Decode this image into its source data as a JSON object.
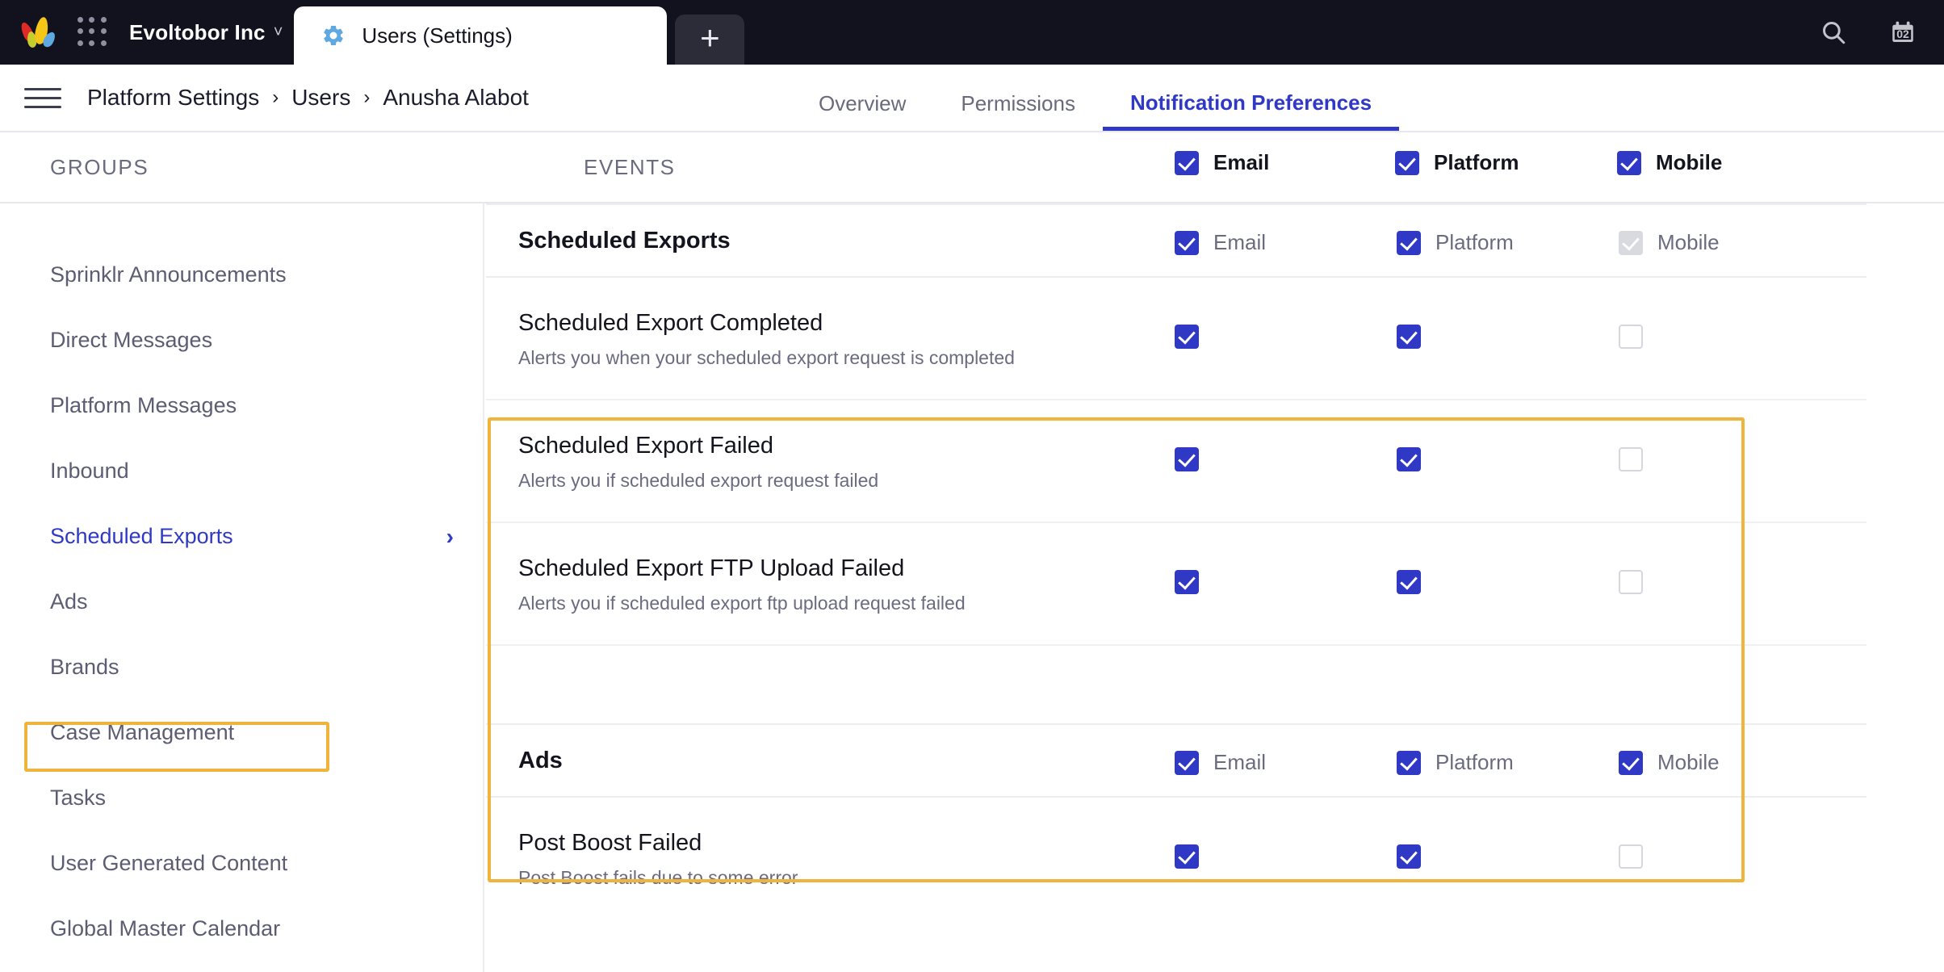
{
  "topbar": {
    "logo_icon": "sprinklr-logo-icon",
    "app_grid_icon": "app-grid-icon",
    "org_name": "Evoltobor Inc",
    "org_caret_icon": "chevron-down-icon",
    "tab_icon": "gear-icon",
    "tab_title": "Users (Settings)",
    "new_tab_label": "+",
    "search_icon": "search-icon",
    "calendar_icon": "calendar-icon",
    "calendar_day": "02"
  },
  "breadcrumb": {
    "menu_icon": "hamburger-menu-icon",
    "items": [
      "Platform Settings",
      "Users",
      "Anusha Alabot"
    ],
    "separator": "›"
  },
  "nav_tabs": [
    {
      "label": "Overview",
      "active": false
    },
    {
      "label": "Permissions",
      "active": false
    },
    {
      "label": "Notification Preferences",
      "active": true
    }
  ],
  "column_header": {
    "groups_label": "GROUPS",
    "events_label": "EVENTS",
    "channels": [
      {
        "label": "Email",
        "state": "on"
      },
      {
        "label": "Platform",
        "state": "on"
      },
      {
        "label": "Mobile",
        "state": "on"
      }
    ]
  },
  "sidebar": {
    "items": [
      {
        "label": "Sprinklr Announcements",
        "selected": false
      },
      {
        "label": "Direct Messages",
        "selected": false
      },
      {
        "label": "Platform Messages",
        "selected": false
      },
      {
        "label": "Inbound",
        "selected": false
      },
      {
        "label": "Scheduled Exports",
        "selected": true,
        "chevron": "›"
      },
      {
        "label": "Ads",
        "selected": false
      },
      {
        "label": "Brands",
        "selected": false
      },
      {
        "label": "Case Management",
        "selected": false
      },
      {
        "label": "Tasks",
        "selected": false
      },
      {
        "label": "User Generated Content",
        "selected": false
      },
      {
        "label": "Global Master Calendar",
        "selected": false
      }
    ]
  },
  "groups": [
    {
      "name": "Scheduled Exports",
      "highlighted": true,
      "channels": [
        {
          "label": "Email",
          "state": "on"
        },
        {
          "label": "Platform",
          "state": "on"
        },
        {
          "label": "Mobile",
          "state": "disabled"
        }
      ],
      "events": [
        {
          "title": "Scheduled Export Completed",
          "description": "Alerts you when your scheduled export request is completed",
          "email": "on",
          "platform": "on",
          "mobile": "off"
        },
        {
          "title": "Scheduled Export Failed",
          "description": "Alerts you if scheduled export request failed",
          "email": "on",
          "platform": "on",
          "mobile": "off"
        },
        {
          "title": "Scheduled Export FTP Upload Failed",
          "description": "Alerts you if scheduled export ftp upload request failed",
          "email": "on",
          "platform": "on",
          "mobile": "off"
        }
      ]
    },
    {
      "name": "Ads",
      "highlighted": false,
      "channels": [
        {
          "label": "Email",
          "state": "on"
        },
        {
          "label": "Platform",
          "state": "on"
        },
        {
          "label": "Mobile",
          "state": "on"
        }
      ],
      "events": [
        {
          "title": "Post Boost Failed",
          "description": "Post Boost fails due to some error",
          "email": "on",
          "platform": "on",
          "mobile": "off"
        }
      ]
    }
  ],
  "colors": {
    "accent_blue": "#2f39c6",
    "highlight_orange": "#eeb43c",
    "topbar_bg": "#12121f",
    "text_muted": "#6b6b80"
  }
}
